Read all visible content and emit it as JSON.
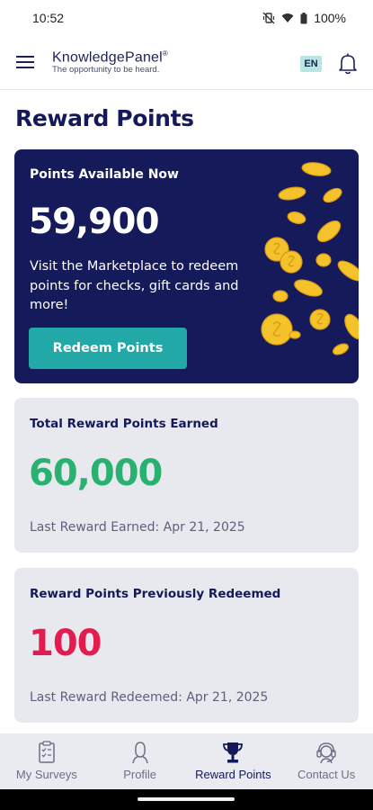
{
  "status_bar": {
    "time": "10:52",
    "battery": "100%",
    "icons": [
      "vibrate-off-icon",
      "wifi-icon",
      "battery-icon"
    ]
  },
  "header": {
    "brand_name": "KnowledgePanel",
    "brand_mark": "®",
    "tagline": "The opportunity to be heard.",
    "language": "EN",
    "icons": [
      "hamburger-menu-icon",
      "bell-icon"
    ]
  },
  "page": {
    "title": "Reward Points"
  },
  "available": {
    "label": "Points Available Now",
    "value": "59,900",
    "description": "Visit the Marketplace to redeem points for checks, gift cards and more!",
    "button": "Redeem Points"
  },
  "earned": {
    "label": "Total Reward Points Earned",
    "value": "60,000",
    "footnote": "Last Reward Earned: Apr 21, 2025"
  },
  "redeemed": {
    "label": "Reward Points Previously Redeemed",
    "value": "100",
    "footnote": "Last Reward Redeemed: Apr 21, 2025"
  },
  "bottom_nav": {
    "items": [
      {
        "label": "My Surveys",
        "icon": "clipboard-checklist-icon",
        "active": false
      },
      {
        "label": "Profile",
        "icon": "person-icon",
        "active": false
      },
      {
        "label": "Reward Points",
        "icon": "trophy-icon",
        "active": true
      },
      {
        "label": "Contact Us",
        "icon": "headset-icon",
        "active": false
      }
    ]
  },
  "colors": {
    "navy": "#151a5b",
    "teal_button": "#22a8a6",
    "earned_green": "#29b170",
    "redeemed_red": "#e41b4f",
    "card_gray": "#e8e9ef",
    "coin_gold": "#f4c22b"
  }
}
